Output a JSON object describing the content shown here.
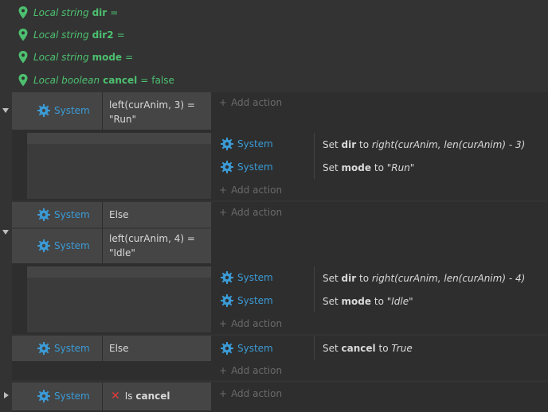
{
  "locals": [
    {
      "prefix": "Local string",
      "name": "dir",
      "suffix": "=",
      "value": ""
    },
    {
      "prefix": "Local string",
      "name": "dir2",
      "suffix": "=",
      "value": ""
    },
    {
      "prefix": "Local string",
      "name": "mode",
      "suffix": "=",
      "value": ""
    },
    {
      "prefix": "Local boolean",
      "name": "cancel",
      "suffix": "=",
      "value": "false"
    }
  ],
  "object_label": "System",
  "add_action_label": "Add action",
  "colors": {
    "accent": "#3b9bd6",
    "local_var": "#4dc070",
    "invert_x": "#e23b3b"
  },
  "event1": {
    "condition": "left(curAnim, 3) =\n\"Run\"",
    "sub_actions": [
      {
        "prefix": "Set",
        "var": "dir",
        "mid": "to",
        "expr": "right(curAnim, len(curAnim) - 3)"
      },
      {
        "prefix": "Set",
        "var": "mode",
        "mid": "to",
        "expr": "\"Run\""
      }
    ]
  },
  "event2": {
    "else_label": "Else",
    "condition": "left(curAnim, 4) =\n\"Idle\"",
    "sub_actions": [
      {
        "prefix": "Set",
        "var": "dir",
        "mid": "to",
        "expr": "right(curAnim, len(curAnim) - 4)"
      },
      {
        "prefix": "Set",
        "var": "mode",
        "mid": "to",
        "expr": "\"Idle\""
      }
    ]
  },
  "event3": {
    "else_label": "Else",
    "action": {
      "prefix": "Set",
      "var": "cancel",
      "mid": "to",
      "expr": "True"
    }
  },
  "event4": {
    "condition_prefix": "Is",
    "condition_name": "cancel"
  }
}
